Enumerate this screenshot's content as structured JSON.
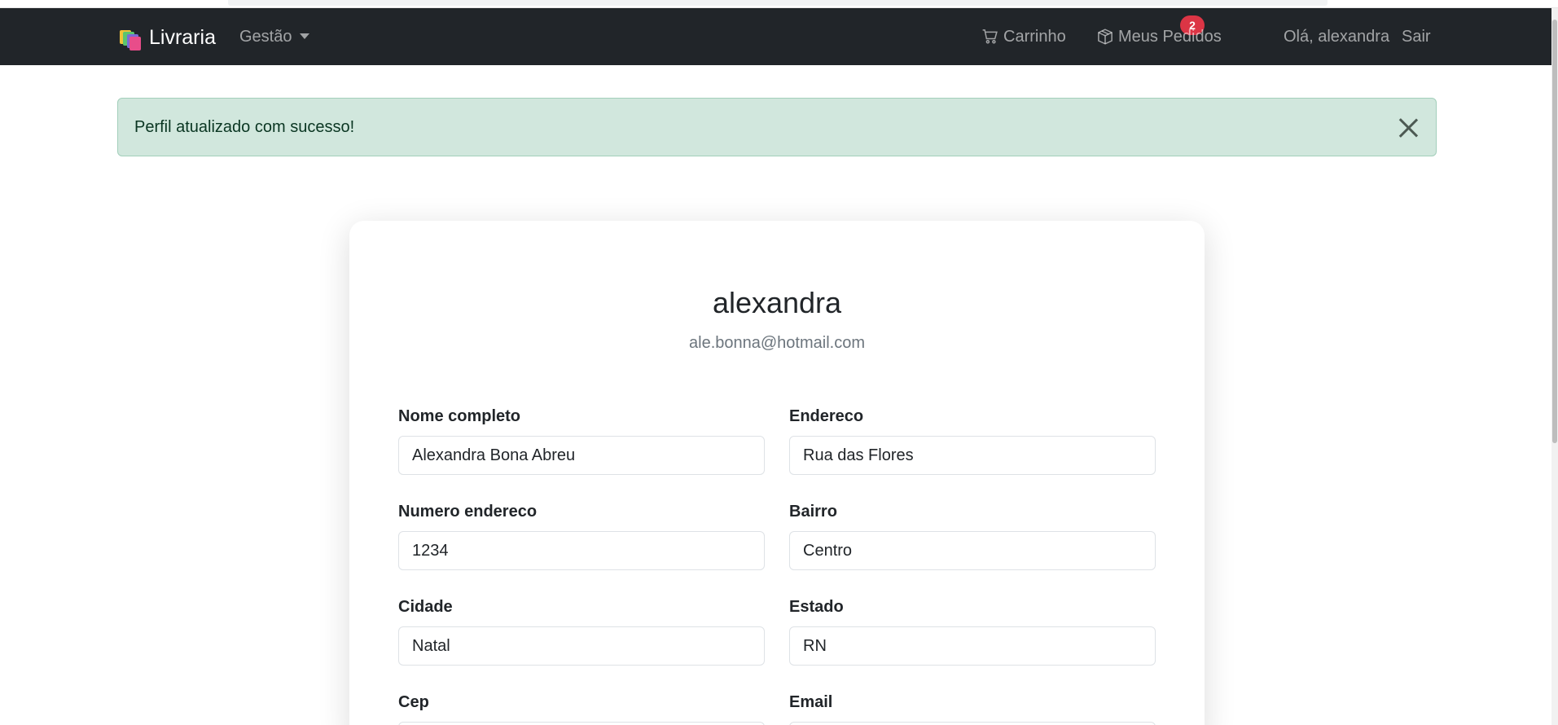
{
  "navbar": {
    "brand": "Livraria",
    "management_menu": "Gestão",
    "cart": {
      "label": "Carrinho",
      "count": "2"
    },
    "orders": "Meus Pedidos",
    "greeting": "Olá, alexandra",
    "logout": "Sair"
  },
  "alert": {
    "message": "Perfil atualizado com sucesso!",
    "color": "#d1e7dd"
  },
  "profile": {
    "username": "alexandra",
    "email": "ale.bonna@hotmail.com"
  },
  "form": {
    "fields": [
      {
        "label": "Nome completo",
        "value": "Alexandra Bona Abreu"
      },
      {
        "label": "Endereco",
        "value": "Rua das Flores"
      },
      {
        "label": "Numero endereco",
        "value": "1234"
      },
      {
        "label": "Bairro",
        "value": "Centro"
      },
      {
        "label": "Cidade",
        "value": "Natal"
      },
      {
        "label": "Estado",
        "value": "RN"
      },
      {
        "label": "Cep",
        "value": ""
      },
      {
        "label": "Email",
        "value": ""
      }
    ]
  },
  "colors": {
    "navbar": "#212529",
    "badge": "#dc3545"
  },
  "icons": [
    "cart-icon",
    "box-icon",
    "close-icon",
    "caret-down-icon"
  ]
}
